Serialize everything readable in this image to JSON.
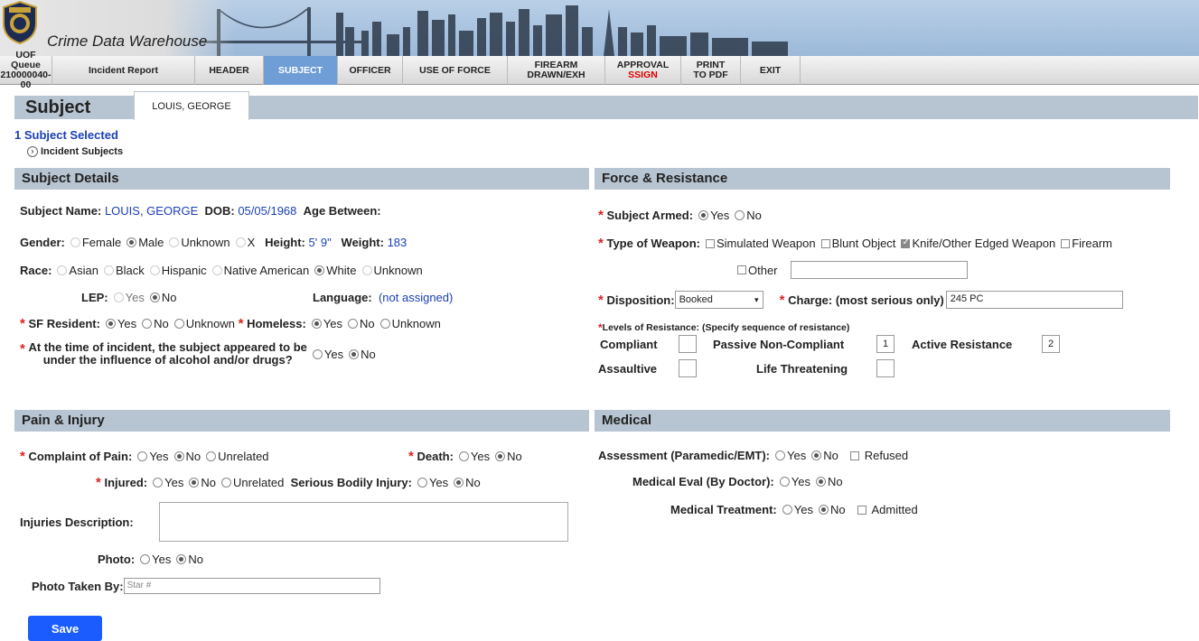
{
  "app": {
    "title": "Crime Data Warehouse"
  },
  "nav": {
    "uof_queue_line1": "UOF Queue",
    "uof_queue_line2": "210000040-00",
    "incident_report": "Incident Report",
    "header": "HEADER",
    "subject": "SUBJECT",
    "officer": "OFFICER",
    "use_of_force": "USE OF FORCE",
    "firearm_line1": "FIREARM",
    "firearm_line2": "DRAWN/EXH",
    "approval_line1": "APPROVAL",
    "approval_line2": "SSIGN",
    "print_line1": "PRINT",
    "print_line2": "TO PDF",
    "exit": "EXIT"
  },
  "section": {
    "title": "Subject",
    "subject_tab": "LOUIS, GEORGE",
    "selected": "1 Subject Selected",
    "incident_subjects": "Incident Subjects"
  },
  "details": {
    "header": "Subject Details",
    "name_label": "Subject Name:",
    "name": "LOUIS, GEORGE",
    "dob_label": "DOB:",
    "dob": "05/05/1968",
    "age_label": "Age Between:",
    "gender_label": "Gender:",
    "gender_options": [
      "Female",
      "Male",
      "Unknown",
      "X"
    ],
    "height_label": "Height:",
    "height": "5' 9\"",
    "weight_label": "Weight:",
    "weight": "183",
    "race_label": "Race:",
    "race_options": [
      "Asian",
      "Black",
      "Hispanic",
      "Native American",
      "White",
      "Unknown"
    ],
    "lep_label": "LEP:",
    "yes": "Yes",
    "no": "No",
    "unknown": "Unknown",
    "language_label": "Language:",
    "language": "(not assigned)",
    "sf_resident_label": "SF Resident:",
    "homeless_label": "Homeless:",
    "influence_line1": "At the time of incident, the subject appeared to be",
    "influence_line2": "under the influence of alcohol and/or drugs?"
  },
  "force": {
    "header": "Force & Resistance",
    "armed_label": "Subject Armed:",
    "weapon_label": "Type of Weapon:",
    "weapon_options": [
      "Simulated Weapon",
      "Blunt Object",
      "Knife/Other Edged Weapon",
      "Firearm",
      "Other"
    ],
    "disposition_label": "Disposition:",
    "disposition": "Booked",
    "charge_label": "Charge: (most serious only)",
    "charge": "245 PC",
    "levels_label": "Levels of Resistance: (Specify sequence of resistance)",
    "compliant": "Compliant",
    "passive": "Passive Non-Compliant",
    "passive_val": "1",
    "active": "Active Resistance",
    "active_val": "2",
    "assaultive": "Assaultive",
    "life": "Life Threatening"
  },
  "pain": {
    "header": "Pain & Injury",
    "complaint_label": "Complaint of Pain:",
    "unrelated": "Unrelated",
    "death_label": "Death:",
    "injured_label": "Injured:",
    "sbi_label": "Serious Bodily Injury:",
    "injuries_desc_label": "Injuries Description:",
    "photo_label": "Photo:",
    "photo_by_label": "Photo Taken By:",
    "photo_by_placeholder": "Star #"
  },
  "medical": {
    "header": "Medical",
    "assessment_label": "Assessment (Paramedic/EMT):",
    "refused": "Refused",
    "eval_label": "Medical Eval (By Doctor):",
    "treatment_label": "Medical Treatment:",
    "admitted": "Admitted"
  },
  "actions": {
    "save": "Save"
  }
}
